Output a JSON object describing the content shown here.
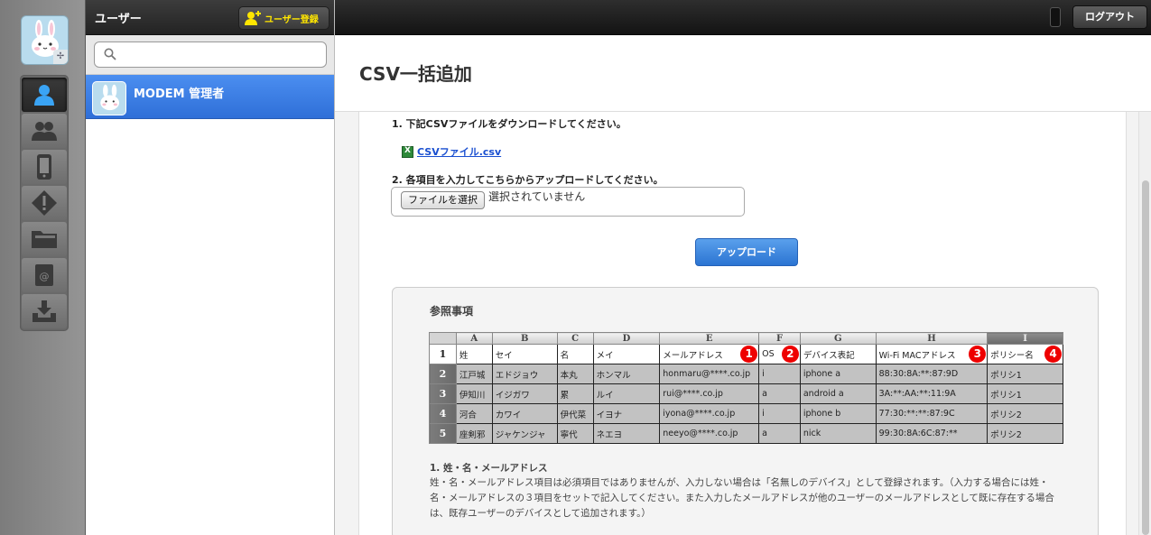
{
  "app": {
    "user_panel_title": "ユーザー",
    "register_button": "ユーザー登録",
    "logout_button": "ログアウト"
  },
  "search": {
    "placeholder": ""
  },
  "users": [
    {
      "name": "MODEM 管理者"
    }
  ],
  "page": {
    "title": "CSV一括追加",
    "step1": "1. 下記CSVファイルをダウンロードしてください。",
    "csv_link": "CSVファイル.csv",
    "step2": "2. 各項目を入力してこちらからアップロードしてください。",
    "choose_file": "ファイルを選択",
    "no_file": "選択されていません",
    "upload_button": "アップロード"
  },
  "reference": {
    "title": "参照事項",
    "columns": [
      "A",
      "B",
      "C",
      "D",
      "E",
      "F",
      "G",
      "H",
      "I"
    ],
    "row_numbers": [
      "1",
      "2",
      "3",
      "4",
      "5"
    ],
    "header_row": [
      "姓",
      "セイ",
      "名",
      "メイ",
      "メールアドレス",
      "OS",
      "デバイス表記",
      "Wi-Fi MACアドレス",
      "ポリシー名"
    ],
    "markers": [
      "1",
      "2",
      "3",
      "4"
    ],
    "rows": [
      [
        "江戸城",
        "エドジョウ",
        "本丸",
        "ホンマル",
        "honmaru@****.co.jp",
        "i",
        "iphone a",
        "88:30:8A:**:87:9D",
        "ポリシ1"
      ],
      [
        "伊知川",
        "イジガワ",
        "累",
        "ルイ",
        "rui@****.co.jp",
        "a",
        "android a",
        "3A:**:AA:**:11:9A",
        "ポリシ1"
      ],
      [
        "河合",
        "カワイ",
        "伊代菜",
        "イヨナ",
        "iyona@****.co.jp",
        "i",
        "iphone b",
        "77:30:**:**:87:9C",
        "ポリシ2"
      ],
      [
        "座剣邪",
        "ジャケンジャ",
        "寧代",
        "ネエヨ",
        "neeyo@****.co.jp",
        "a",
        "nick",
        "99:30:8A:6C:87:**",
        "ポリシ2"
      ]
    ],
    "note_title": "1. 姓・名・メールアドレス",
    "note_body": "姓・名・メールアドレス項目は必須項目ではありませんが、入力しない場合は「名無しのデバイス」として登録されます。（入力する場合には姓・名・メールアドレスの３項目をセットで記入してください。また入力したメールアドレスが他のユーザーのメールアドレスとして既に存在する場合は、既存ユーザーのデバイスとして追加されます。）"
  }
}
